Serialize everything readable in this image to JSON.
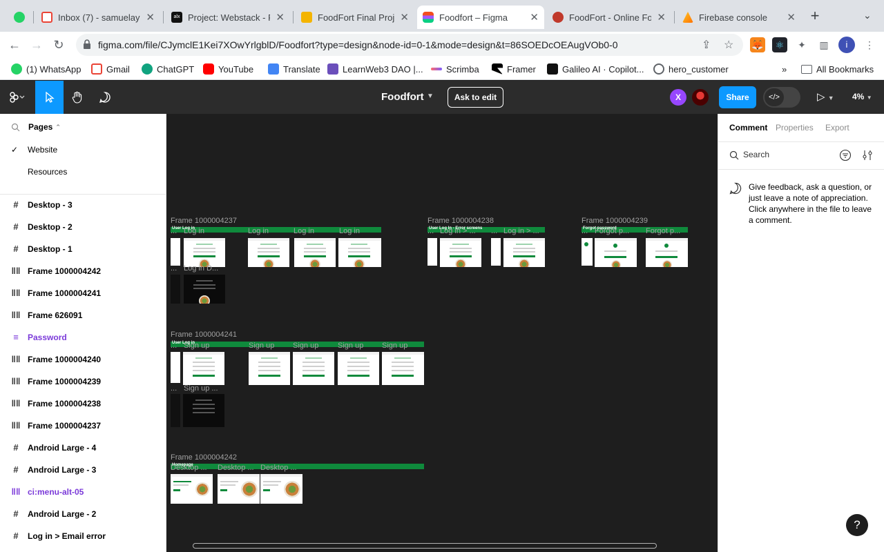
{
  "browser": {
    "tabs": [
      {
        "title": "",
        "icon": "whatsapp-icon",
        "color": "#25d366"
      },
      {
        "title": "Inbox (7) - samuelayo",
        "icon": "gmail-icon",
        "color": "#ea4335"
      },
      {
        "title": "Project: Webstack - F",
        "icon": "alx-icon",
        "color": "#111111"
      },
      {
        "title": "FoodFort Final Projec",
        "icon": "slides-icon",
        "color": "#f4b400"
      },
      {
        "title": "Foodfort – Figma",
        "icon": "figma-icon",
        "color": "#f24e1e"
      },
      {
        "title": "FoodFort - Online Fo",
        "icon": "foodfort-icon",
        "color": "#c0392b"
      },
      {
        "title": "Firebase console",
        "icon": "firebase-icon",
        "color": "#ffa000"
      }
    ],
    "url": "figma.com/file/CJymclE1Kei7XOwYrlgblD/Foodfort?type=design&node-id=0-1&mode=design&t=86SOEDcOEAugVOb0-0",
    "profile_initial": "i",
    "bookmarks": [
      {
        "label": "(1) WhatsApp",
        "color": "#25d366"
      },
      {
        "label": "Gmail",
        "color": "#ea4335"
      },
      {
        "label": "ChatGPT",
        "color": "#10a37f"
      },
      {
        "label": "YouTube",
        "color": "#ff0000"
      },
      {
        "label": "Translate",
        "color": "#4285f4"
      },
      {
        "label": "LearnWeb3 DAO |...",
        "color": "#6b4fbb"
      },
      {
        "label": "Scrimba",
        "color": "#7c5cff"
      },
      {
        "label": "Framer",
        "color": "#000000"
      },
      {
        "label": "Galileo AI · Copilot...",
        "color": "#111111"
      },
      {
        "label": "hero_customer",
        "color": "#5f6368"
      }
    ],
    "all_bookmarks": "All Bookmarks",
    "overflow": "»"
  },
  "figma": {
    "file_name": "Foodfort",
    "ask_to_edit": "Ask to edit",
    "avatar_x": "X",
    "share": "Share",
    "zoom": "4%",
    "pages_title": "Pages",
    "pages": [
      {
        "label": "Website",
        "selected": true
      },
      {
        "label": "Resources",
        "selected": false
      }
    ],
    "layers": [
      {
        "label": "Desktop - 3",
        "kind": "frame"
      },
      {
        "label": "Desktop - 2",
        "kind": "frame"
      },
      {
        "label": "Desktop - 1",
        "kind": "frame"
      },
      {
        "label": "Frame 1000004242",
        "kind": "autolayout"
      },
      {
        "label": "Frame 1000004241",
        "kind": "autolayout"
      },
      {
        "label": "Frame 626091",
        "kind": "autolayout"
      },
      {
        "label": "Password",
        "kind": "component-text"
      },
      {
        "label": "Frame 1000004240",
        "kind": "autolayout"
      },
      {
        "label": "Frame 1000004239",
        "kind": "autolayout"
      },
      {
        "label": "Frame 1000004238",
        "kind": "autolayout"
      },
      {
        "label": "Frame 1000004237",
        "kind": "autolayout"
      },
      {
        "label": "Android Large - 4",
        "kind": "frame"
      },
      {
        "label": "Android Large - 3",
        "kind": "frame"
      },
      {
        "label": "ci:menu-alt-05",
        "kind": "component"
      },
      {
        "label": "Android Large - 2",
        "kind": "frame"
      },
      {
        "label": "Log in > Email error",
        "kind": "frame"
      }
    ],
    "canvas": {
      "frames": [
        {
          "label": "Frame 1000004237",
          "bar_label": "User Log in",
          "thumbs": [
            "...",
            "Log in",
            "Log in",
            "Log in",
            "Log in"
          ],
          "row2": [
            "...",
            "Log in D..."
          ]
        },
        {
          "label": "Frame 1000004238",
          "bar_label": "User Log In - Error screens",
          "thumbs": [
            "...",
            "Log in > ...",
            "...",
            "Log in > ..."
          ]
        },
        {
          "label": "Frame 1000004239",
          "bar_label": "Forgot password",
          "thumbs": [
            "...",
            "Forgot p...",
            "Forgot p..."
          ]
        },
        {
          "label": "Frame 1000004241",
          "bar_label": "User Log in",
          "thumbs": [
            "...",
            "Sign up",
            "Sign up",
            "Sign up",
            "Sign up",
            "Sign up"
          ],
          "row2": [
            "...",
            "Sign up ..."
          ]
        },
        {
          "label": "Frame 1000004242",
          "bar_label": "Homepage",
          "thumbs": [
            "Desktop ...",
            "Desktop ...",
            "Desktop ..."
          ]
        }
      ]
    },
    "right_panel": {
      "tabs": [
        "Comment",
        "Properties",
        "Export"
      ],
      "search_placeholder": "Search",
      "hint": "Give feedback, ask a question, or just leave a note of appreciation. Click anywhere in the file to leave a comment.",
      "help": "?"
    }
  },
  "colors": {
    "accent": "#0d99ff",
    "component": "#7b3ad9",
    "frame_bar": "#0f8a3c"
  }
}
